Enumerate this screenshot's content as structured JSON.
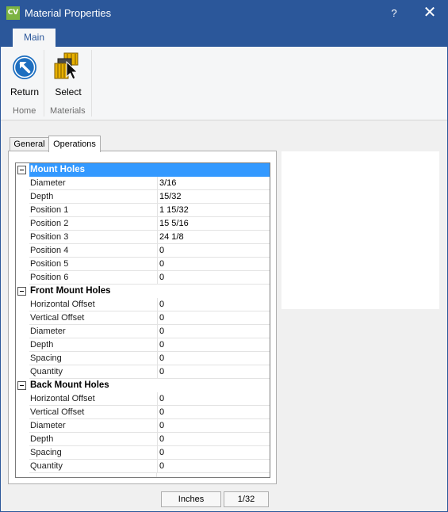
{
  "window": {
    "app_icon_text": "CV",
    "title": "Material Properties",
    "help_label": "?",
    "close_label": "✕"
  },
  "ribbon": {
    "tabs": [
      {
        "label": "Main",
        "active": true
      }
    ],
    "buttons": [
      {
        "label": "Return",
        "icon": "return-arrow-icon",
        "group": "Home"
      },
      {
        "label": "Select",
        "icon": "select-materials-icon",
        "group": "Materials"
      }
    ],
    "groups": [
      "Home",
      "Materials"
    ]
  },
  "tabs": [
    {
      "label": "General",
      "active": false
    },
    {
      "label": "Operations",
      "active": true
    }
  ],
  "property_grid": {
    "categories": [
      {
        "name": "Mount Holes",
        "selected": true,
        "rows": [
          {
            "name": "Diameter",
            "value": "3/16"
          },
          {
            "name": "Depth",
            "value": "15/32"
          },
          {
            "name": "Position 1",
            "value": "1 15/32"
          },
          {
            "name": "Position 2",
            "value": "15 5/16"
          },
          {
            "name": "Position 3",
            "value": "24 1/8"
          },
          {
            "name": "Position 4",
            "value": "0"
          },
          {
            "name": "Position 5",
            "value": "0"
          },
          {
            "name": "Position 6",
            "value": "0"
          }
        ]
      },
      {
        "name": "Front Mount Holes",
        "selected": false,
        "rows": [
          {
            "name": "Horizontal Offset",
            "value": "0"
          },
          {
            "name": "Vertical Offset",
            "value": "0"
          },
          {
            "name": "Diameter",
            "value": "0"
          },
          {
            "name": "Depth",
            "value": "0"
          },
          {
            "name": "Spacing",
            "value": "0"
          },
          {
            "name": "Quantity",
            "value": "0"
          }
        ]
      },
      {
        "name": "Back Mount Holes",
        "selected": false,
        "rows": [
          {
            "name": "Horizontal Offset",
            "value": "0"
          },
          {
            "name": "Vertical Offset",
            "value": "0"
          },
          {
            "name": "Diameter",
            "value": "0"
          },
          {
            "name": "Depth",
            "value": "0"
          },
          {
            "name": "Spacing",
            "value": "0"
          },
          {
            "name": "Quantity",
            "value": "0"
          }
        ]
      }
    ]
  },
  "status": {
    "units": "Inches",
    "precision": "1/32"
  },
  "colors": {
    "title_bar": "#2b579a",
    "selection": "#3399ff",
    "return_icon": "#1e6fc0",
    "select_icon_gold": "#e8b000"
  }
}
